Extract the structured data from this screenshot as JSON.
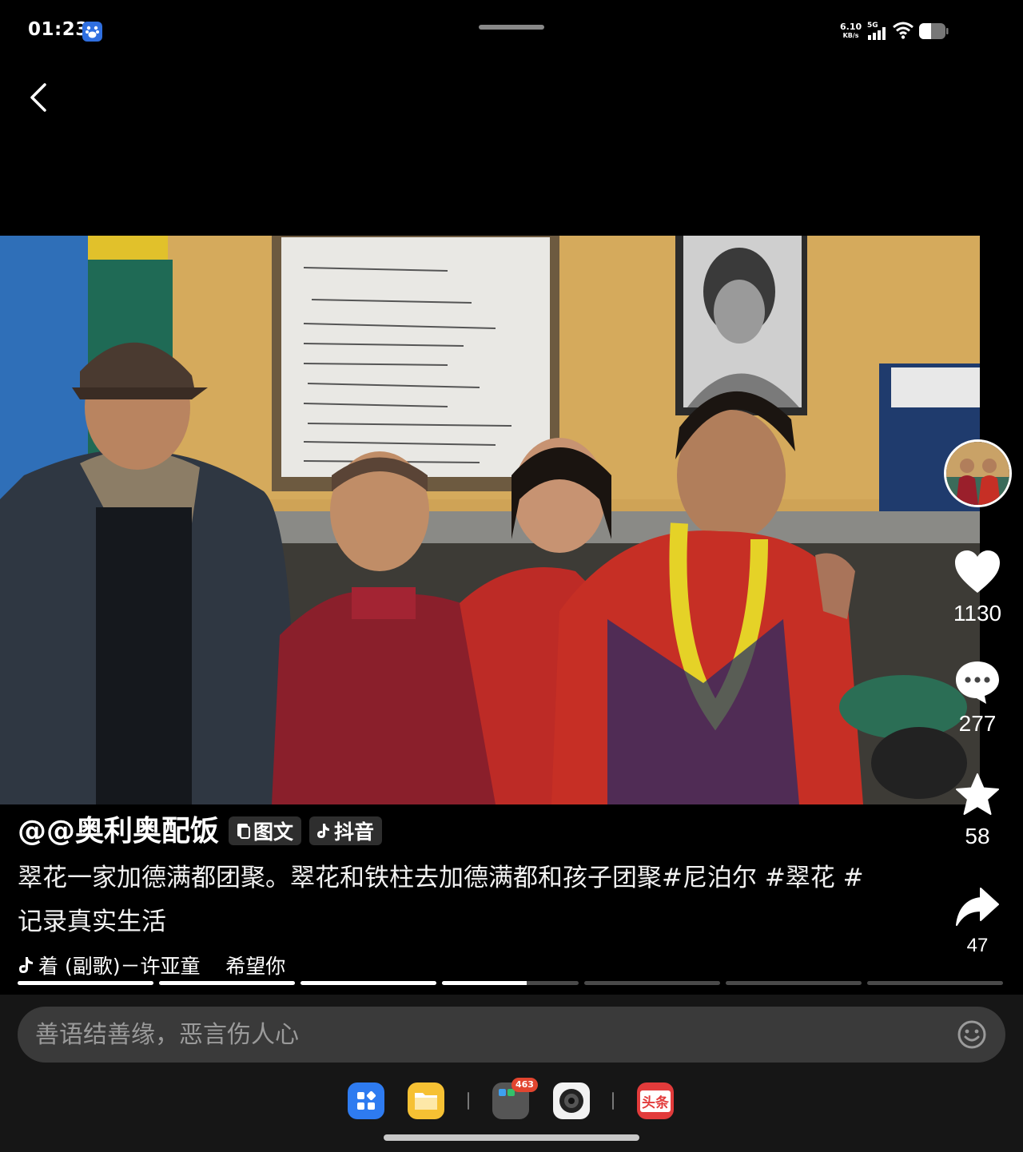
{
  "status_bar": {
    "time": "01:23",
    "net_speed_value": "6.10",
    "net_speed_unit": "KB/s",
    "network_type": "5G",
    "icons": [
      "baidu-icon",
      "signal-icon",
      "wifi-icon",
      "battery-icon"
    ]
  },
  "video": {
    "author_handle": "@@奥利奥配饭",
    "tags": [
      "图文",
      "抖音"
    ],
    "description": "翠花一家加德满都团聚。翠花和铁柱去加德满都和孩子团聚#尼泊尔 #翠花 #记录真实生活",
    "music": "着 (副歌)－许亚童    希望你"
  },
  "actions": {
    "likes": "1130",
    "comments": "277",
    "favorites": "58",
    "shares": "47"
  },
  "progress": {
    "segments": 7,
    "current_segment_index": 3,
    "current_segment_fraction": 0.62
  },
  "comment_box": {
    "placeholder": "善语结善缘，恶言伤人心"
  },
  "dock": {
    "apps": [
      "app-launcher-icon",
      "files-icon",
      "folder-icon",
      "camera-icon",
      "toutiao-icon"
    ],
    "toutiao_label": "头条",
    "folder_badge": "463"
  },
  "colors": {
    "background": "#000000",
    "panel": "#161616",
    "input": "#3a3a3a",
    "badge": "#e2452f",
    "toutiao": "#e23b3b"
  }
}
